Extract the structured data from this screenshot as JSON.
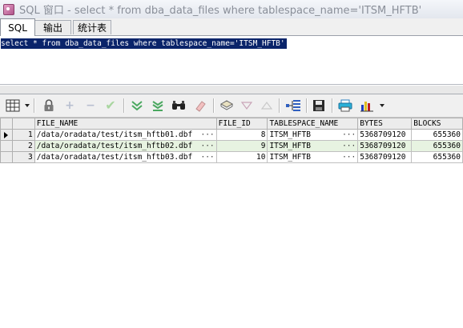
{
  "window": {
    "title": "SQL 窗口 - select * from dba_data_files where tablespace_name='ITSM_HFTB'"
  },
  "tabs": [
    {
      "label": "SQL"
    },
    {
      "label": "输出"
    },
    {
      "label": "统计表"
    }
  ],
  "editor": {
    "sql": "select * from dba_data_files where tablespace_name='ITSM_HFTB'"
  },
  "toolbar": {
    "icons": [
      "grid-layout-icon",
      "lock-icon",
      "add-record-icon",
      "delete-record-icon",
      "post-changes-icon",
      "fetch-next-icon",
      "fetch-all-icon",
      "find-icon",
      "clear-icon",
      "query-by-example-icon",
      "sort-descending-icon",
      "sort-ascending-icon",
      "export-tree-icon",
      "save-icon",
      "print-icon",
      "chart-icon"
    ]
  },
  "grid": {
    "columns": [
      "FILE_NAME",
      "FILE_ID",
      "TABLESPACE_NAME",
      "BYTES",
      "BLOCKS"
    ],
    "rows": [
      {
        "num": "1",
        "file_name": "/data/oradata/test/itsm_hftb01.dbf",
        "file_id": "8",
        "tablespace_name": "ITSM_HFTB",
        "bytes": "5368709120",
        "blocks": "655360"
      },
      {
        "num": "2",
        "file_name": "/data/oradata/test/itsm_hftb02.dbf",
        "file_id": "9",
        "tablespace_name": "ITSM_HFTB",
        "bytes": "5368709120",
        "blocks": "655360"
      },
      {
        "num": "3",
        "file_name": "/data/oradata/test/itsm_hftb03.dbf",
        "file_id": "10",
        "tablespace_name": "ITSM_HFTB",
        "bytes": "5368709120",
        "blocks": "655360"
      }
    ],
    "ellipsis": "···",
    "colors": {
      "even_row": "#e7f3e1",
      "selection": "#0a246a"
    }
  }
}
